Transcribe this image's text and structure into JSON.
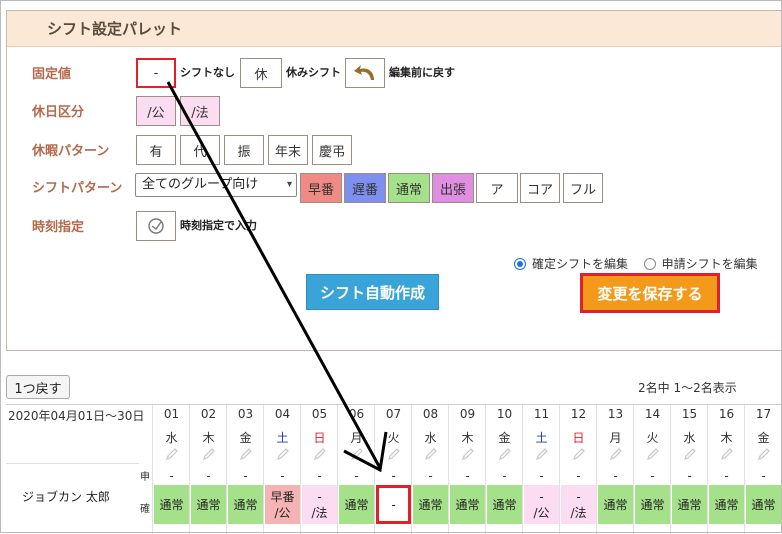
{
  "panel": {
    "title": "シフト設定パレット",
    "rows": {
      "fixed": "固定値",
      "holiday_class": "休日区分",
      "leave_pattern": "休暇パターン",
      "shift_pattern": "シフトパターン",
      "time_spec": "時刻指定"
    },
    "fixed": {
      "none_value": "-",
      "none_label": "シフトなし",
      "rest_value": "休",
      "rest_label": "休みシフト",
      "undo_label": "編集前に戻す"
    },
    "holiday_buttons": [
      "/公",
      "/法"
    ],
    "leave_buttons": [
      "有",
      "代",
      "振",
      "年末",
      "慶弔"
    ],
    "shift_select": "全てのグループ向け",
    "shift_buttons": [
      {
        "label": "早番",
        "color": "#f08a84"
      },
      {
        "label": "遅番",
        "color": "#7f8ff0"
      },
      {
        "label": "通常",
        "color": "#a5e08a"
      },
      {
        "label": "出張",
        "color": "#e08fe0"
      },
      {
        "label": "ア",
        "color": "#ffffff"
      },
      {
        "label": "コア",
        "color": "#ffffff"
      },
      {
        "label": "フル",
        "color": "#ffffff"
      }
    ],
    "time_label": "時刻指定で入力",
    "radio": {
      "confirmed": "確定シフトを編集",
      "requested": "申請シフトを編集"
    },
    "auto_button": "シフト自動作成",
    "save_button": "変更を保存する"
  },
  "table": {
    "back_button": "1つ戻す",
    "count_text": "2名中 1〜2名表示",
    "date_range": "2020年04月01日〜30日",
    "employee": "ジョブカン 太郎",
    "mark_request": "申",
    "mark_confirm": "確",
    "days": [
      {
        "day": "01",
        "wd": "水",
        "req": "-",
        "shift": "通常"
      },
      {
        "day": "02",
        "wd": "木",
        "req": "-",
        "shift": "通常"
      },
      {
        "day": "03",
        "wd": "金",
        "req": "-",
        "shift": "通常"
      },
      {
        "day": "04",
        "wd": "土",
        "req": "-",
        "shift": "早番\n/公"
      },
      {
        "day": "05",
        "wd": "日",
        "req": "-",
        "shift": "-\n/法"
      },
      {
        "day": "06",
        "wd": "月",
        "req": "-",
        "shift": "通常"
      },
      {
        "day": "07",
        "wd": "火",
        "req": "-",
        "shift": "-"
      },
      {
        "day": "08",
        "wd": "水",
        "req": "-",
        "shift": "通常"
      },
      {
        "day": "09",
        "wd": "木",
        "req": "-",
        "shift": "通常"
      },
      {
        "day": "10",
        "wd": "金",
        "req": "-",
        "shift": "通常"
      },
      {
        "day": "11",
        "wd": "土",
        "req": "-",
        "shift": "-\n/公"
      },
      {
        "day": "12",
        "wd": "日",
        "req": "-",
        "shift": "-\n/法"
      },
      {
        "day": "13",
        "wd": "月",
        "req": "-",
        "shift": "通常"
      },
      {
        "day": "14",
        "wd": "火",
        "req": "-",
        "shift": "通常"
      },
      {
        "day": "15",
        "wd": "水",
        "req": "-",
        "shift": "通常"
      },
      {
        "day": "16",
        "wd": "木",
        "req": "-",
        "shift": "通常"
      },
      {
        "day": "17",
        "wd": "金",
        "req": "-",
        "shift": "通常"
      }
    ]
  }
}
